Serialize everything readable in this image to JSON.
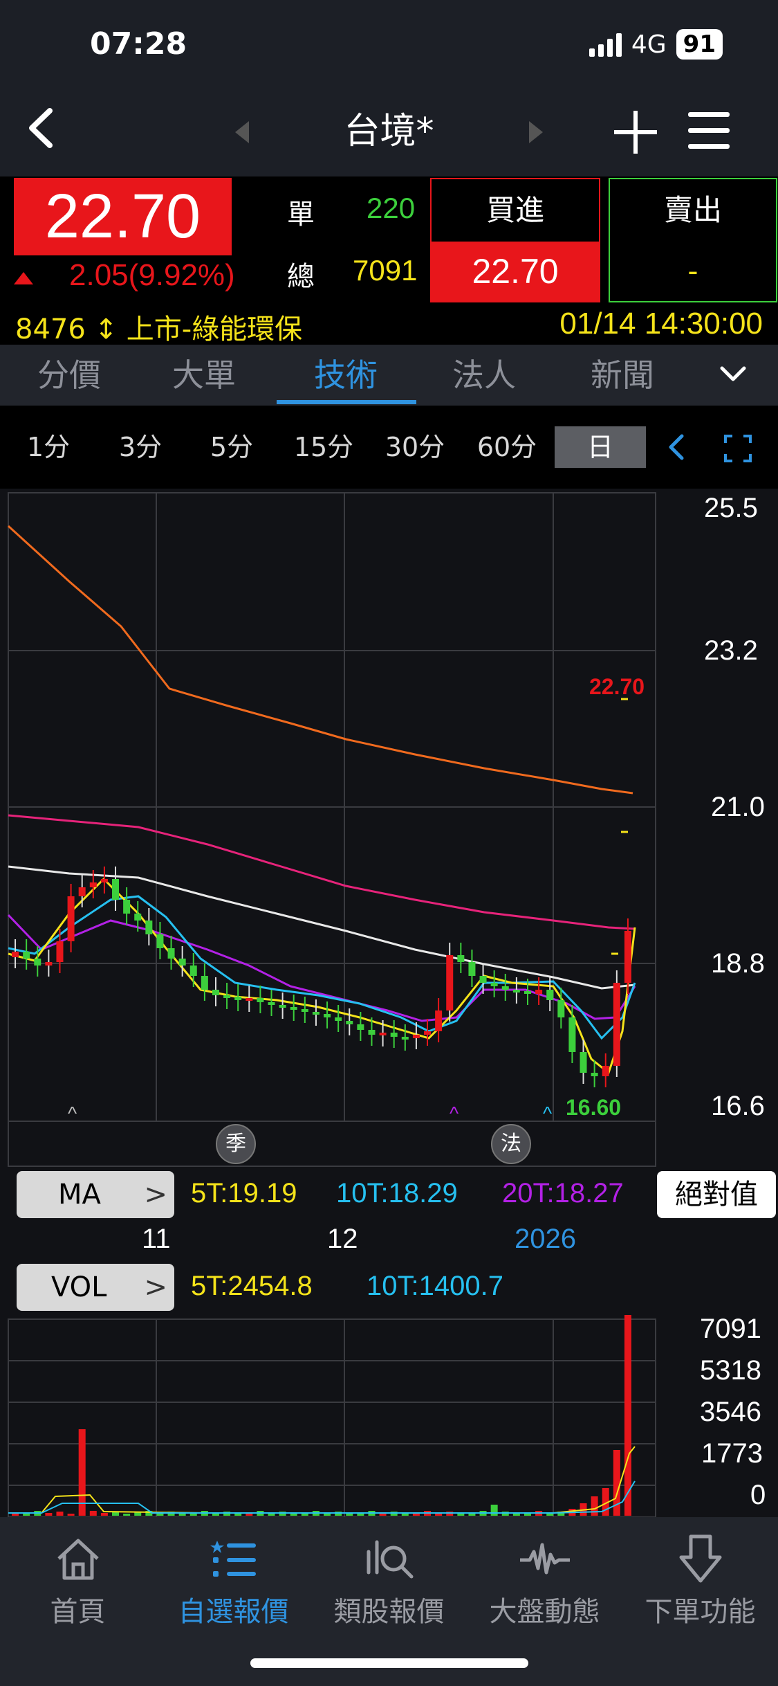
{
  "status": {
    "time": "07:28",
    "network": "4G",
    "battery": "91"
  },
  "nav": {
    "title": "台境*",
    "back_icon": "chevron-left-icon",
    "add_icon": "plus-icon",
    "menu_icon": "hamburger-icon"
  },
  "quote": {
    "price": "22.70",
    "change": "2.05(9.92%)",
    "single_label": "單",
    "single_value": "220",
    "total_label": "總",
    "total_value": "7091",
    "buy_label": "買進",
    "buy_price": "22.70",
    "sell_label": "賣出",
    "sell_price": "-",
    "code_info": "8476 ↕ 上市-綠能環保",
    "datetime": "01/14 14:30:00",
    "colors": {
      "up": "#e8161b",
      "down": "#3ccf3c",
      "accent": "#f5e31a"
    }
  },
  "tabs": [
    "分價",
    "大單",
    "技術",
    "法人",
    "新聞"
  ],
  "active_tab": "技術",
  "periods": [
    "1分",
    "3分",
    "5分",
    "15分",
    "30分",
    "60分",
    "日"
  ],
  "active_period": "日",
  "chart": {
    "price_axis": [
      "25.5",
      "23.2",
      "21.0",
      "18.8",
      "16.6"
    ],
    "price_tag": "22.70",
    "low_tag": "16.60",
    "event_markers": [
      "季",
      "法"
    ],
    "x_labels": [
      "11",
      "12",
      "2026"
    ],
    "ma_button": "MA",
    "ma_values": [
      "5T:19.19",
      "10T:18.29",
      "20T:18.27"
    ],
    "abs_button": "絕對值",
    "vol_button": "VOL",
    "vol_values": [
      "5T:2454.8",
      "10T:1400.7"
    ],
    "vol_axis": [
      "7091",
      "5318",
      "3546",
      "1773",
      "0"
    ]
  },
  "bottom_nav": [
    {
      "label": "首頁",
      "icon": "home-icon"
    },
    {
      "label": "自選報價",
      "icon": "watchlist-icon"
    },
    {
      "label": "類股報價",
      "icon": "sector-search-icon"
    },
    {
      "label": "大盤動態",
      "icon": "pulse-icon"
    },
    {
      "label": "下單功能",
      "icon": "order-arrow-icon"
    }
  ],
  "active_nav": "自選報價"
}
